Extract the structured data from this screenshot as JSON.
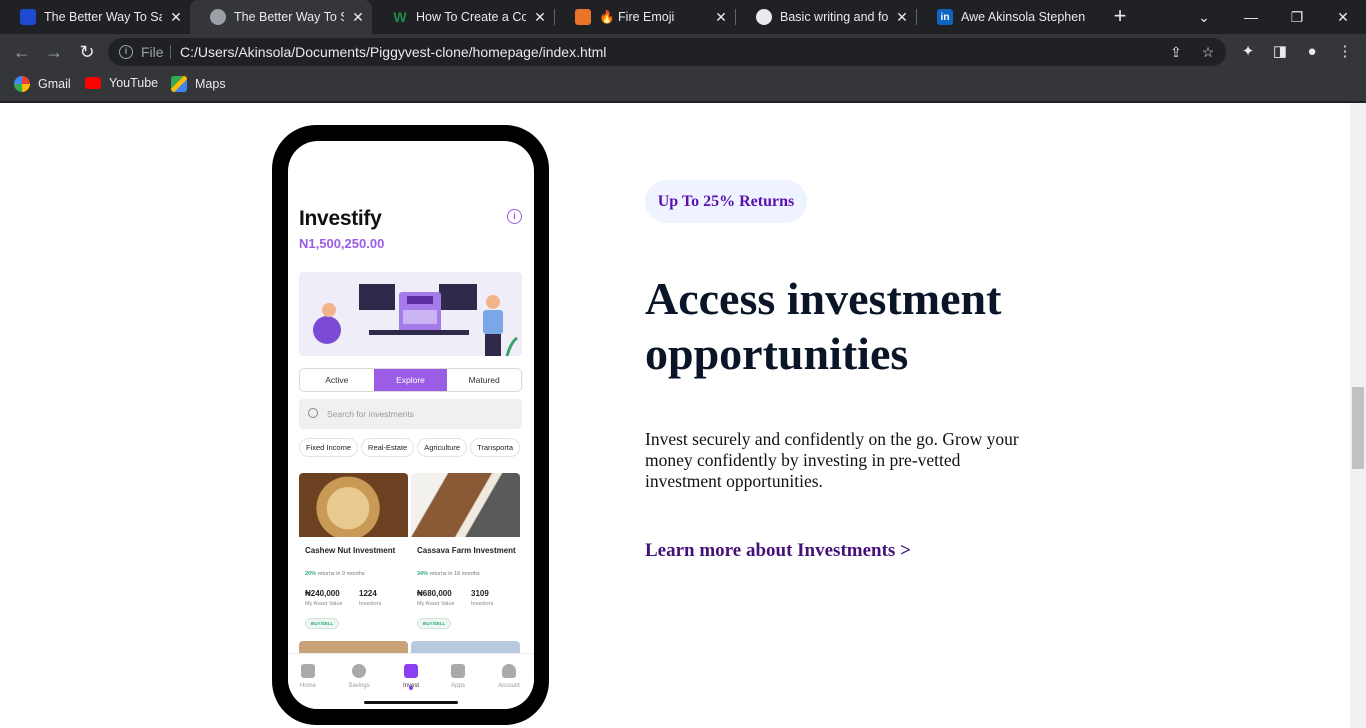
{
  "browser": {
    "tabs": [
      {
        "title": "The Better Way To Sav",
        "favicon": "piggyvest-icon",
        "color": "#1e4bd1"
      },
      {
        "title": "The Better Way To Sav",
        "favicon": "globe-icon",
        "color": "#9aa0a6",
        "active": true
      },
      {
        "title": "How To Create a Colla",
        "favicon": "w-icon",
        "color": "#1f8a4c",
        "glyph": "W"
      },
      {
        "title": "🔥 Fire Emoji",
        "favicon": "emojipedia-icon",
        "color": "#e8742a"
      },
      {
        "title": "Basic writing and form",
        "favicon": "github-icon",
        "color": "#e8eaed"
      },
      {
        "title": "Awe Akinsola Stephen",
        "favicon": "linkedin-icon",
        "color": "#0a66c2",
        "glyph": "in"
      }
    ],
    "url_scheme": "File",
    "url": "C:/Users/Akinsola/Documents/Piggyvest-clone/homepage/index.html",
    "bookmarks": [
      {
        "label": "Gmail",
        "icon": "google-icon"
      },
      {
        "label": "YouTube",
        "icon": "youtube-icon"
      },
      {
        "label": "Maps",
        "icon": "maps-icon"
      }
    ]
  },
  "phone": {
    "app_title": "Investify",
    "balance": "N1,500,250.00",
    "segments": [
      "Active",
      "Explore",
      "Matured"
    ],
    "active_segment": "Explore",
    "search_placeholder": "Search for investments",
    "chips": [
      "Fixed Income",
      "Real-Estate",
      "Agriculture",
      "Transporta"
    ],
    "cards": [
      {
        "name": "Cashew Nut Investment",
        "return_pct": "20%",
        "return_text": "returns in 9 months",
        "asset_value": "₦240,000",
        "asset_label": "My Asset Value",
        "investors": "1224",
        "investors_label": "Investors",
        "action": "BUY/SELL"
      },
      {
        "name": "Cassava Farm Investment",
        "return_pct": "34%",
        "return_text": "returns in 18 months",
        "asset_value": "₦680,000",
        "asset_label": "My Asset Value",
        "investors": "3109",
        "investors_label": "Investors",
        "action": "BUY/SELL"
      }
    ],
    "nav": [
      "Home",
      "Savings",
      "Invest",
      "Apps",
      "Account"
    ],
    "active_nav": "Invest"
  },
  "content": {
    "badge": "Up To 25% Returns",
    "headline": "Access investment opportunities",
    "description": "Invest securely and confidently on the go. Grow your money confidently by investing in pre-vetted investment opportunities.",
    "cta": "Learn more about Investments >"
  }
}
